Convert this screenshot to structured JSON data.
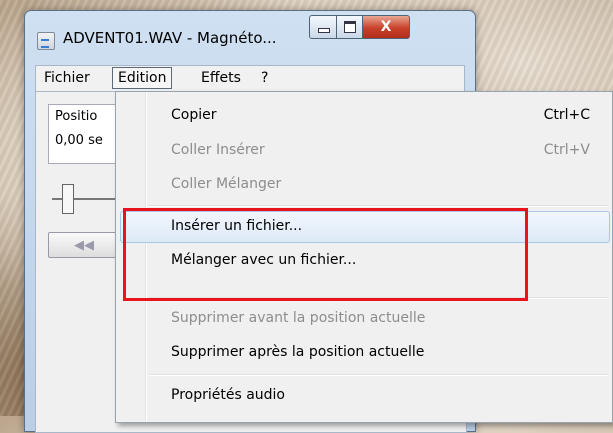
{
  "window": {
    "title": "ADVENT01.WAV - Magnéto...",
    "close_glyph": "X"
  },
  "menubar": {
    "items": [
      "Fichier",
      "Edition",
      "Effets",
      "?"
    ]
  },
  "client": {
    "position_label": "Positio",
    "position_value": "0,00 se",
    "rewind_glyph": "◀◀"
  },
  "edit_menu": {
    "items": [
      {
        "label": "Copier",
        "shortcut": "Ctrl+C",
        "enabled": true
      },
      {
        "label": "Coller Insérer",
        "shortcut": "Ctrl+V",
        "enabled": false
      },
      {
        "label": "Coller Mélanger",
        "shortcut": "",
        "enabled": false
      },
      {
        "label": "Insérer un fichier...",
        "shortcut": "",
        "enabled": true,
        "hovered": true
      },
      {
        "label": "Mélanger avec un fichier...",
        "shortcut": "",
        "enabled": true
      },
      {
        "label": "Supprimer avant la position actuelle",
        "shortcut": "",
        "enabled": false
      },
      {
        "label": "Supprimer après la position actuelle",
        "shortcut": "",
        "enabled": true
      },
      {
        "label": "Propriétés audio",
        "shortcut": "",
        "enabled": true
      }
    ]
  },
  "colors": {
    "highlight_box": "#e8141b",
    "disabled_text": "#8d8d8d",
    "hover_border": "#a8c7e8"
  }
}
